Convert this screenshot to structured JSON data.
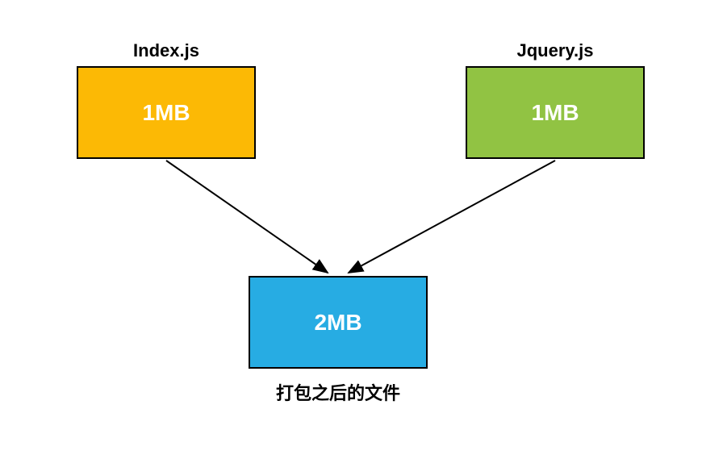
{
  "diagram": {
    "left": {
      "label": "Index.js",
      "size": "1MB",
      "color": "#fcb905"
    },
    "right": {
      "label": "Jquery.js",
      "size": "1MB",
      "color": "#91c343"
    },
    "bottom": {
      "label": "打包之后的文件",
      "size": "2MB",
      "color": "#27ace3"
    }
  }
}
